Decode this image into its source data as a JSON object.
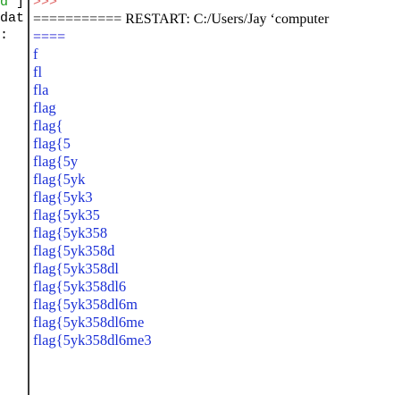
{
  "gutter": {
    "line1_green": "d",
    "line1_rest": " ]",
    "line2": "dat",
    "line3": ":"
  },
  "shell": {
    "prompt": ">>>",
    "restart_text": "=========== RESTART: C:/Users/Jay ‘computer",
    "restart_continuation": "====",
    "output_lines": [
      "f",
      "fl",
      "fla",
      "flag",
      "flag{",
      "flag{5",
      "flag{5y",
      "flag{5yk",
      "flag{5yk3",
      "flag{5yk35",
      "flag{5yk358",
      "flag{5yk358d",
      "flag{5yk358dl",
      "flag{5yk358dl6",
      "flag{5yk358dl6m",
      "flag{5yk358dl6me",
      "flag{5yk358dl6me3"
    ]
  },
  "colors": {
    "output_text": "#1a2fd6",
    "prompt_text": "#e06a6a",
    "restart_text": "#000000",
    "gutter_green": "#1a9a1a"
  }
}
